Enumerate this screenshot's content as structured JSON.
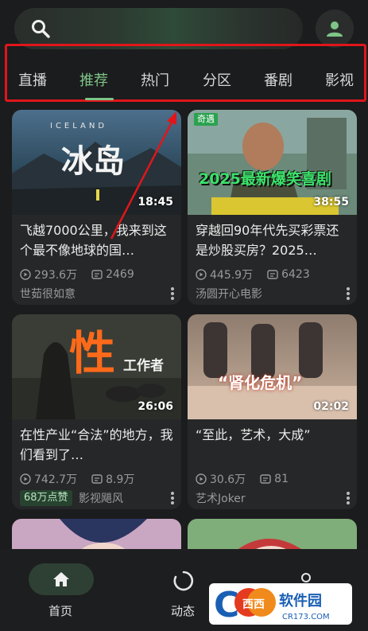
{
  "tabs": [
    "直播",
    "推荐",
    "热门",
    "分区",
    "番剧",
    "影视"
  ],
  "active_tab": "推荐",
  "colors": {
    "accent": "#7ec488",
    "highlight_box": "#e0161b",
    "background": "#1b1c1d",
    "card": "#262728"
  },
  "cards": [
    {
      "thumb_text_top": "ICELAND",
      "thumb_text": "冰岛",
      "duration": "18:45",
      "title": "飞越7000公里，我来到这个最不像地球的国…",
      "views": "293.6万",
      "danmaku": "2469",
      "author": "世茹很如意"
    },
    {
      "thumb_badge": "奇遇",
      "thumb_text": "2025最新爆笑喜剧",
      "duration": "38:55",
      "title": "穿越回90年代先买彩票还是炒股买房？2025…",
      "views": "445.9万",
      "danmaku": "6423",
      "author": "汤圆开心电影"
    },
    {
      "thumb_text": "性",
      "thumb_text_sub": "工作者",
      "duration": "26:06",
      "title": "在性产业“合法”的地方，我们看到了…",
      "views": "742.7万",
      "danmaku": "8.9万",
      "badge": "68万点赞",
      "author": "影视飓风"
    },
    {
      "thumb_text": "“肾化危机”",
      "duration": "02:02",
      "title": "“至此，艺术，大成”",
      "views": "30.6万",
      "danmaku": "81",
      "author": "艺术Joker"
    }
  ],
  "bottom_nav": [
    {
      "label": "首页",
      "icon": "home-icon",
      "active": true
    },
    {
      "label": "动态",
      "icon": "dynamic-icon",
      "active": false
    },
    {
      "label": "我的",
      "icon": "user-icon",
      "active": false
    }
  ],
  "watermark": {
    "brand": "西西软件园",
    "url": "CR173.COM"
  }
}
